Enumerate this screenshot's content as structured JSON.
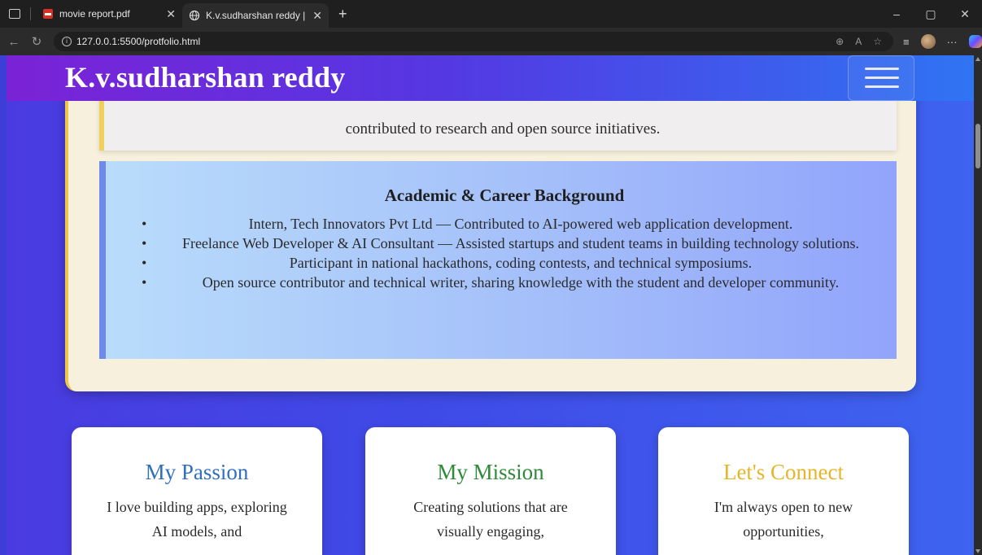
{
  "browser": {
    "tabs": [
      {
        "label": "movie report.pdf",
        "icon": "pdf-icon"
      },
      {
        "label": "K.v.sudharshan reddy | Portfolio",
        "icon": "globe-icon",
        "active": true
      }
    ],
    "url": "127.0.0.1:5500/protfolio.html"
  },
  "header": {
    "title": "K.v.sudharshan reddy",
    "menu_icon": "hamburger-icon"
  },
  "about": {
    "previous_text": "contributed to research and open source initiatives.",
    "career": {
      "title": "Academic & Career Background",
      "items": [
        "Intern, Tech Innovators Pvt Ltd — Contributed to AI-powered web application development.",
        "Freelance Web Developer & AI Consultant — Assisted startups and student teams in building technology solutions.",
        "Participant in national hackathons, coding contests, and technical symposiums.",
        "Open source contributor and technical writer, sharing knowledge with the student and developer community."
      ]
    }
  },
  "cards": [
    {
      "title": "My Passion",
      "text": "I love building apps, exploring AI models, and",
      "color": "#2f6fbf"
    },
    {
      "title": "My Mission",
      "text": "Creating solutions that are visually engaging,",
      "color": "#2f8a3a"
    },
    {
      "title": "Let's Connect",
      "text": "I'm always open to new opportunities,",
      "color": "#e8b528"
    }
  ],
  "colors": {
    "header_start": "#7b22d6",
    "header_end": "#2f74f3",
    "accent_yellow": "#f1c644",
    "career_border": "#6f8be8"
  }
}
